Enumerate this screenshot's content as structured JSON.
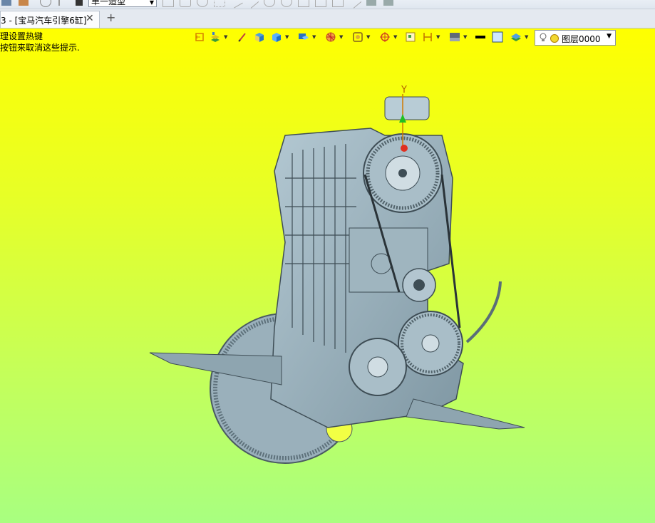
{
  "toolbar": {
    "mode_select_value": "单一造型"
  },
  "tab": {
    "title": "3 - [宝马汽车引擎6缸]",
    "close_glyph": "✕",
    "new_tab_glyph": "+"
  },
  "hint": {
    "line1": "理设置热键",
    "line2": "按钮来取消这些提示."
  },
  "view_toolbar": {
    "layer_name": "图层0000"
  },
  "axis": {
    "y_label": "Y"
  },
  "colors": {
    "bg_top": "#ffff00",
    "bg_bottom": "#a8ff80",
    "model": "#8fa9b5"
  }
}
